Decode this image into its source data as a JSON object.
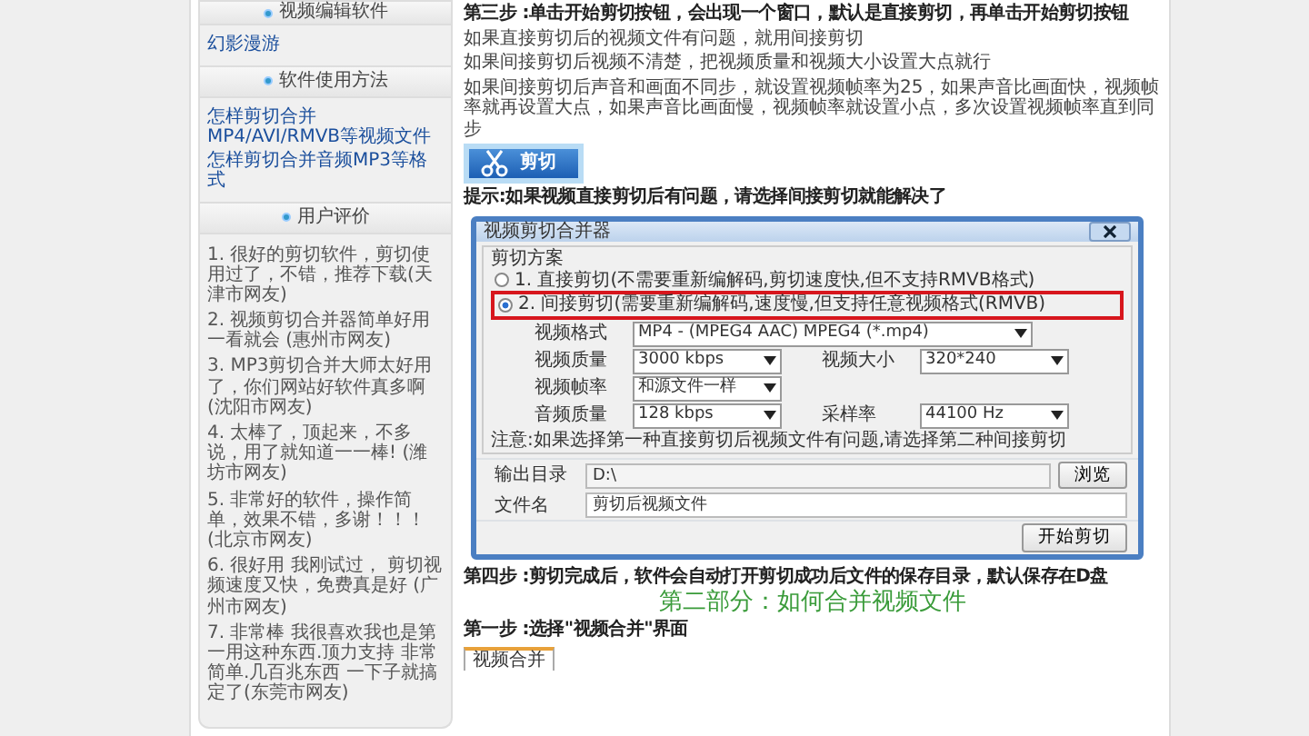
{
  "sidebar": {
    "sections": [
      {
        "title": "视频编辑软件",
        "links": [
          "幻影漫游"
        ]
      },
      {
        "title": "软件使用方法",
        "links": [
          "怎样剪切合并MP4/AVI/RMVB等视频文件",
          "怎样剪切合并音频MP3等格式"
        ]
      },
      {
        "title": "用户评价",
        "reviews": [
          "1. 很好的剪切软件，剪切使用过了，不错，推荐下载(天津市网友)",
          "2. 视频剪切合并器简单好用一看就会 (惠州市网友)",
          "3. MP3剪切合并大师太好用了，你们网站好软件真多啊 (沈阳市网友)",
          "4. 太棒了，顶起来，不多说，用了就知道一一棒! (潍坊市网友)",
          "5. 非常好的软件，操作简单，效果不错，多谢！！！ (北京市网友)",
          "6. 很好用 我刚试过， 剪切视频速度又快，免费真是好 (广州市网友)",
          "7. 非常棒 我很喜欢我也是第一用这种东西.顶力支持 非常简单.几百兆东西 一下子就搞定了(东莞市网友)"
        ]
      }
    ]
  },
  "article": {
    "blocks": [
      {
        "kind": "step",
        "text": "第三步 :单击开始剪切按钮，会出现一个窗口，默认是直接剪切，再单击开始剪切按钮"
      },
      {
        "kind": "para",
        "text": "如果直接剪切后的视频文件有问题，就用间接剪切"
      },
      {
        "kind": "para",
        "text": "如果间接剪切后视频不清楚，把视频质量和视频大小设置大点就行"
      },
      {
        "kind": "para",
        "text": "如果间接剪切后声音和画面不同步，就设置视频帧率为25，如果声音比画面快，视频帧率就再设置大点，如果声音比画面慢，视频帧率就设置小点，多次设置视频帧率直到同步"
      },
      {
        "kind": "image_button",
        "label": "剪切"
      },
      {
        "kind": "step",
        "text": "提示:如果视频直接剪切后有问题，请选择间接剪切就能解决了"
      },
      {
        "kind": "dialog",
        "title": "视频剪切合并器",
        "scheme": {
          "label": "剪切方案",
          "options": [
            {
              "label": "1. 直接剪切(不需要重新编解码,剪切速度快,但不支持RMVB格式)",
              "selected": false
            },
            {
              "label": "2. 间接剪切(需要重新编解码,速度慢,但支持任意视频格式(RMVB)",
              "selected": true
            }
          ]
        },
        "settings": [
          [
            {
              "label": "视频格式",
              "value": "MP4 - (MPEG4 AAC) MPEG4 (*.mp4)",
              "kind": "wide"
            }
          ],
          [
            {
              "label": "视频质量",
              "value": "3000 kbps",
              "kind": "normal"
            },
            {
              "label": "视频大小",
              "value": "320*240",
              "kind": "normal"
            }
          ],
          [
            {
              "label": "视频帧率",
              "value": "和源文件一样",
              "kind": "short"
            }
          ],
          [
            {
              "label": "音频质量",
              "value": "128 kbps",
              "kind": "normal"
            },
            {
              "label": "采样率",
              "value": "44100 Hz",
              "kind": "normal"
            }
          ]
        ],
        "note": "注意:如果选择第一种直接剪切后视频文件有问题,请选择第二种间接剪切",
        "output_dir": {
          "label": "输出目录",
          "value": "D:\\",
          "button": "浏览"
        },
        "filename": {
          "label": "文件名",
          "value": "剪切后视频文件"
        },
        "start_button": "开始剪切"
      },
      {
        "kind": "step",
        "text": "第四步 :剪切完成后，软件会自动打开剪切成功后文件的保存目录，默认保存在D盘"
      },
      {
        "kind": "heading",
        "text": "第二部分：如何合并视频文件"
      },
      {
        "kind": "step",
        "text": "第一步 :选择\"视频合并\"界面"
      },
      {
        "kind": "tab",
        "label": "视频合并"
      }
    ]
  }
}
